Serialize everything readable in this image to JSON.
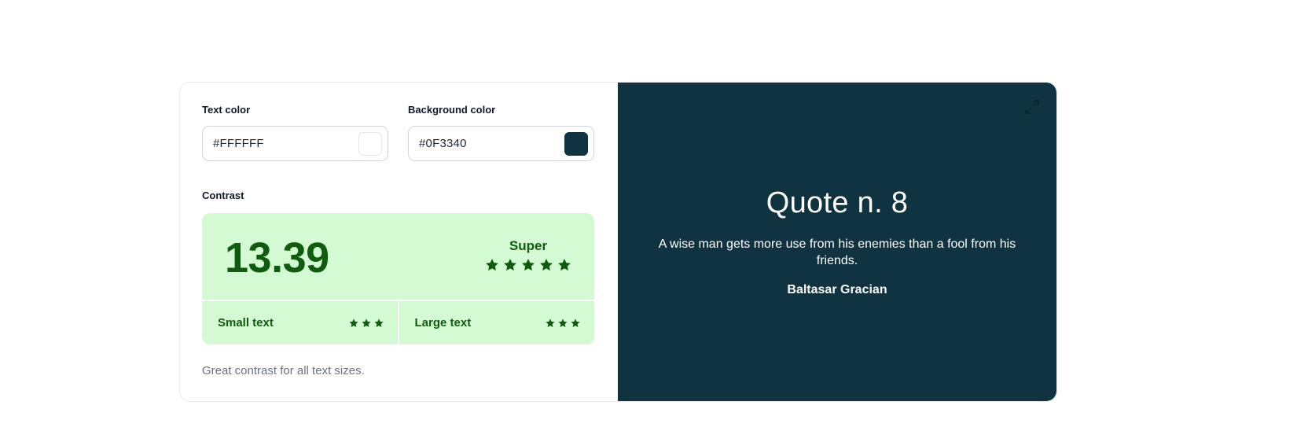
{
  "colors": {
    "contrast_bg": "#d3fad2",
    "contrast_fg": "#0f5c0c",
    "preview_bg": "#0F3340",
    "preview_fg": "#FFFFFF",
    "expand_icon": "#0a2530"
  },
  "text_color": {
    "label": "Text color",
    "value": "#FFFFFF",
    "swatch": "#FFFFFF"
  },
  "background_color": {
    "label": "Background color",
    "value": "#0F3340",
    "swatch": "#0F3340"
  },
  "contrast": {
    "label": "Contrast",
    "ratio": "13.39",
    "rating_label": "Super",
    "rating_stars": 5,
    "small_text": {
      "label": "Small text",
      "stars": 3
    },
    "large_text": {
      "label": "Large text",
      "stars": 3
    },
    "note": "Great contrast for all text sizes."
  },
  "preview": {
    "expand_icon": "expand-icon",
    "title": "Quote n. 8",
    "quote": "A wise man gets more use from his enemies than a fool from his friends.",
    "author": "Baltasar Gracian"
  }
}
